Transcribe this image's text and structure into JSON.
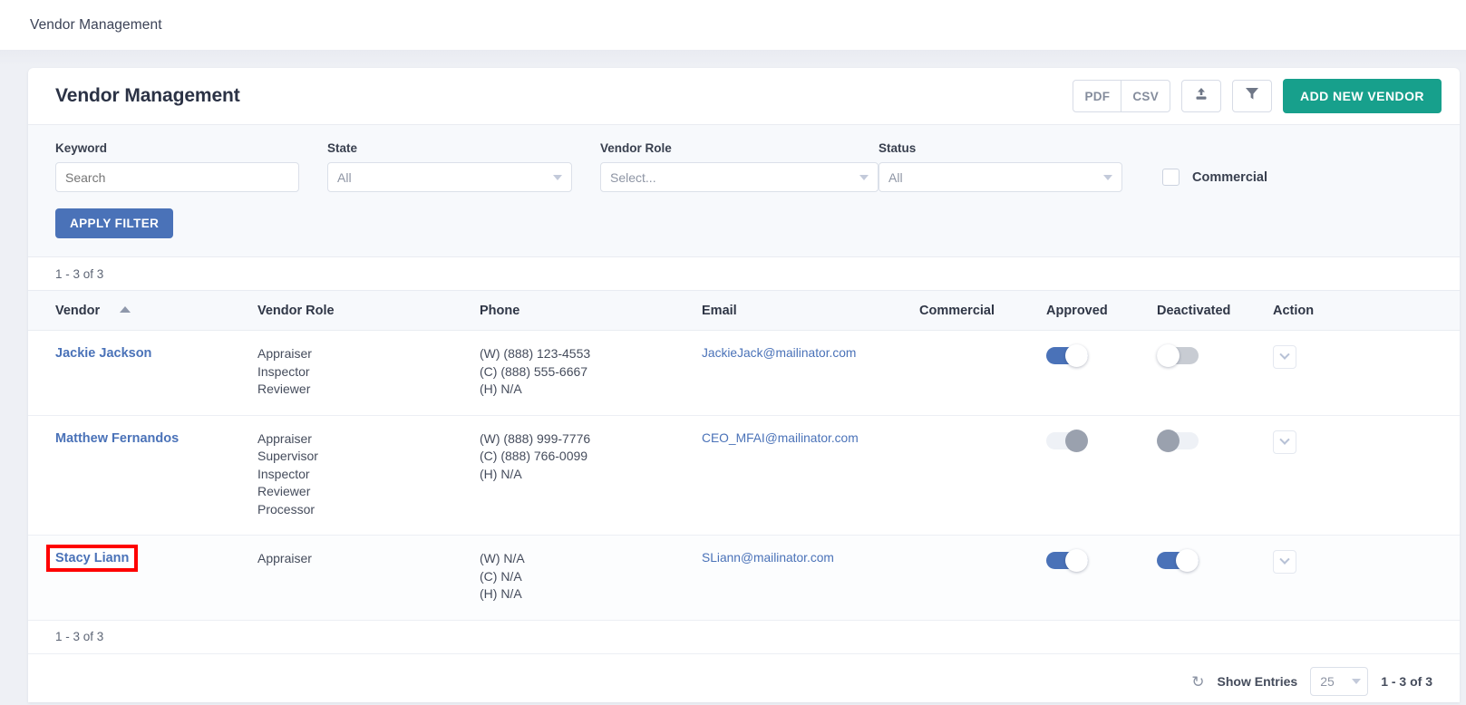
{
  "breadcrumb": {
    "title": "Vendor Management"
  },
  "card": {
    "title": "Vendor Management",
    "toolbar": {
      "pdf_label": "PDF",
      "csv_label": "CSV",
      "upload_icon": "upload-icon",
      "filter_icon": "funnel-icon",
      "add_label": "ADD NEW VENDOR",
      "accent_color": "#17a08c"
    }
  },
  "filters": {
    "keyword": {
      "label": "Keyword",
      "placeholder": "Search",
      "value": ""
    },
    "state": {
      "label": "State",
      "value": "All"
    },
    "vendor_role": {
      "label": "Vendor Role",
      "value": "Select..."
    },
    "status": {
      "label": "Status",
      "value": "All"
    },
    "commercial": {
      "label": "Commercial",
      "checked": false
    },
    "apply_label": "APPLY FILTER",
    "apply_color": "#4a72b8"
  },
  "counts": {
    "top": "1 - 3 of 3",
    "bottom": "1 - 3 of 3"
  },
  "table": {
    "headers": {
      "vendor": "Vendor",
      "vendor_role": "Vendor Role",
      "phone": "Phone",
      "email": "Email",
      "commercial": "Commercial",
      "approved": "Approved",
      "deactivated": "Deactivated",
      "action": "Action"
    },
    "sort": {
      "column": "Vendor",
      "direction": "asc"
    },
    "rows": [
      {
        "vendor": "Jackie Jackson",
        "highlighted": false,
        "roles": [
          "Appraiser",
          "Inspector",
          "Reviewer"
        ],
        "phones": [
          "(W) (888) 123-4553",
          "(C) (888) 555-6667",
          "(H) N/A"
        ],
        "email": "JackieJack@mailinator.com",
        "commercial": "",
        "approved": {
          "state": "on",
          "disabled": false
        },
        "deactivated": {
          "state": "off",
          "disabled": false
        },
        "action_icon": "chevron-down-icon"
      },
      {
        "vendor": "Matthew Fernandos",
        "highlighted": false,
        "roles": [
          "Appraiser",
          "Supervisor",
          "Inspector",
          "Reviewer",
          "Processor"
        ],
        "phones": [
          "(W) (888) 999-7776",
          "(C) (888) 766-0099",
          "(H) N/A"
        ],
        "email": "CEO_MFAI@mailinator.com",
        "commercial": "",
        "approved": {
          "state": "on",
          "disabled": true
        },
        "deactivated": {
          "state": "off",
          "disabled": true
        },
        "action_icon": "chevron-down-icon"
      },
      {
        "vendor": "Stacy Liann",
        "highlighted": true,
        "roles": [
          "Appraiser"
        ],
        "phones": [
          "(W) N/A",
          "(C) N/A",
          "(H) N/A"
        ],
        "email": "SLiann@mailinator.com",
        "commercial": "",
        "approved": {
          "state": "on",
          "disabled": false
        },
        "deactivated": {
          "state": "on",
          "disabled": false
        },
        "action_icon": "chevron-down-icon"
      }
    ]
  },
  "footer": {
    "refresh_icon": "refresh-icon",
    "show_entries_label": "Show Entries",
    "entries_value": "25",
    "range": "1 - 3 of 3"
  }
}
